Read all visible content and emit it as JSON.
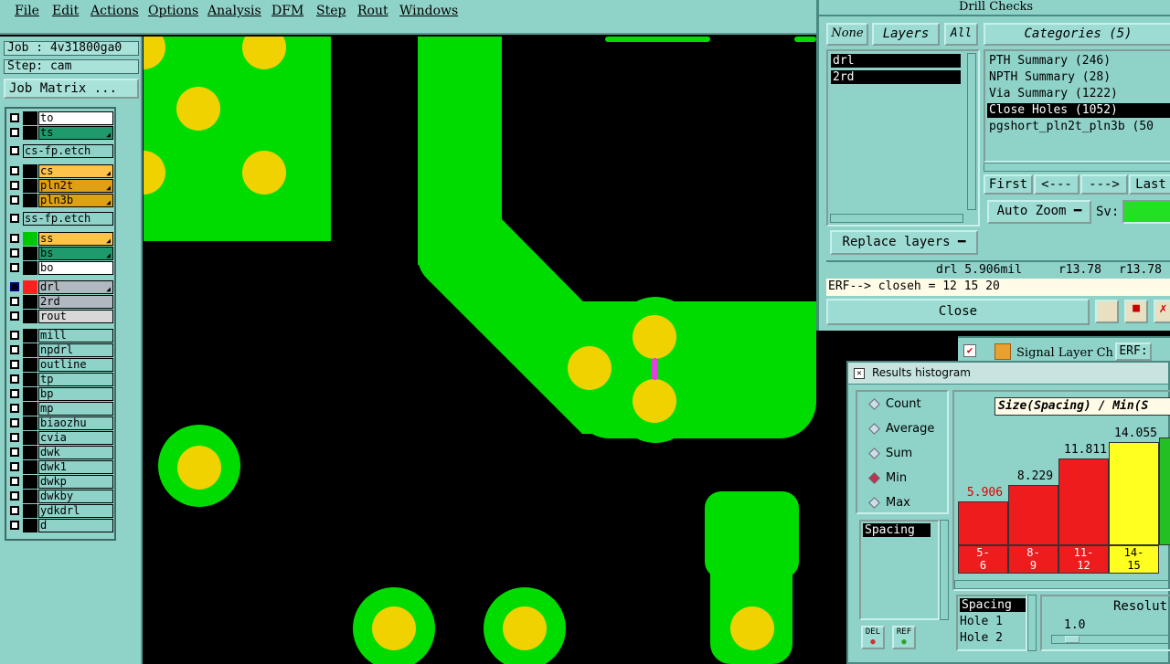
{
  "menubar": {
    "items": [
      "File",
      "Edit",
      "Actions",
      "Options",
      "Analysis",
      "DFM",
      "Step",
      "Rout",
      "Windows"
    ]
  },
  "job": {
    "job": "Job : 4v31800ga0",
    "step": "Step: cam",
    "matrix_label": "Job Matrix ..."
  },
  "layers": [
    {
      "name": "to",
      "color": "#ffffff",
      "swatch": "#000000"
    },
    {
      "name": "ts",
      "color": "#1f9a6c",
      "swatch": "#000000",
      "arrow": true
    },
    {
      "name": "cs-fp.etch",
      "color": "#8fd2c8",
      "swatch": null
    },
    {
      "name": "cs",
      "color": "#ffc24a",
      "swatch": "#000000",
      "arrow": true
    },
    {
      "name": "pln2t",
      "color": "#e0a014",
      "swatch": "#000000",
      "arrow": true
    },
    {
      "name": "pln3b",
      "color": "#e0a014",
      "swatch": "#000000",
      "arrow": true
    },
    {
      "name": "ss-fp.etch",
      "color": "#8fd2c8",
      "swatch": null
    },
    {
      "name": "ss",
      "color": "#ffc24a",
      "swatch": "#00c800",
      "arrow": true
    },
    {
      "name": "bs",
      "color": "#1f9a6c",
      "swatch": "#000000",
      "arrow": true
    },
    {
      "name": "bo",
      "color": "#ffffff",
      "swatch": "#000000"
    },
    {
      "name": "drl",
      "color": "#b0b8c0",
      "swatch": "#ff2020",
      "arrow": true
    },
    {
      "name": "2rd",
      "color": "#b0b8c0",
      "swatch": "#000000"
    },
    {
      "name": "rout",
      "color": "#d8d8d8",
      "swatch": "#000000"
    },
    {
      "name": "mill",
      "color": "#8fd2c8",
      "swatch": "#000000"
    },
    {
      "name": "npdrl",
      "color": "#8fd2c8",
      "swatch": "#000000"
    },
    {
      "name": "outline",
      "color": "#8fd2c8",
      "swatch": "#000000"
    },
    {
      "name": "tp",
      "color": "#8fd2c8",
      "swatch": "#000000"
    },
    {
      "name": "bp",
      "color": "#8fd2c8",
      "swatch": "#000000"
    },
    {
      "name": "mp",
      "color": "#8fd2c8",
      "swatch": "#000000"
    },
    {
      "name": "biaozhu",
      "color": "#8fd2c8",
      "swatch": "#000000"
    },
    {
      "name": "cvia",
      "color": "#8fd2c8",
      "swatch": "#000000"
    },
    {
      "name": "dwk",
      "color": "#8fd2c8",
      "swatch": "#000000"
    },
    {
      "name": "dwk1",
      "color": "#8fd2c8",
      "swatch": "#000000"
    },
    {
      "name": "dwkp",
      "color": "#8fd2c8",
      "swatch": "#000000"
    },
    {
      "name": "dwkby",
      "color": "#8fd2c8",
      "swatch": "#000000"
    },
    {
      "name": "ydkdrl",
      "color": "#8fd2c8",
      "swatch": "#000000"
    },
    {
      "name": "d",
      "color": "#8fd2c8",
      "swatch": "#000000"
    }
  ],
  "drill": {
    "title": "Drill Checks",
    "none_label": "None",
    "layers_label": "Layers",
    "all_label": "All",
    "layer_items": [
      "drl",
      "2rd"
    ],
    "categories_label": "Categories (5)",
    "categories": [
      "PTH Summary (246)",
      "NPTH Summary (28)",
      "Via Summary (1222)",
      "Close Holes (1052)",
      "pgshort_pln2t_pln3b (50"
    ],
    "nav": [
      "First",
      "<---",
      "--->",
      "Last"
    ],
    "autozoom_label": "Auto Zoom",
    "sv_label": "Sv:",
    "replace_label": "Replace layers",
    "status_left": "drl 5.906mil",
    "status_mid": "r13.78",
    "status_right": "r13.78",
    "erf_line": "ERF--> closeh = 12 15 20",
    "close_label": "Close"
  },
  "signal": {
    "title": "Signal Layer Ch",
    "erf": "ERF:"
  },
  "hist": {
    "title": "Results histogram",
    "modes": [
      "Count",
      "Average",
      "Sum",
      "Min",
      "Max"
    ],
    "selected_mode": "Min",
    "list_item": "Spacing",
    "del_label": "DEL",
    "ref_label": "REF",
    "chart_title": "Size(Spacing) / Min(S",
    "bottom_list": [
      "Spacing",
      "Hole 1",
      "Hole 2"
    ],
    "resolution_label": "Resolut",
    "resolution_value": "1.0"
  },
  "chart_data": {
    "type": "bar",
    "categories": [
      "5-\n6",
      "8-\n9",
      "11-\n12",
      "14-\n15"
    ],
    "values": [
      5.906,
      8.229,
      11.811,
      14.055
    ],
    "value_labels": [
      "5.906",
      "8.229",
      "11.811",
      "14.055"
    ],
    "colors": [
      "#ee1c1c",
      "#ee1c1c",
      "#ee1c1c",
      "#ffff20"
    ]
  }
}
